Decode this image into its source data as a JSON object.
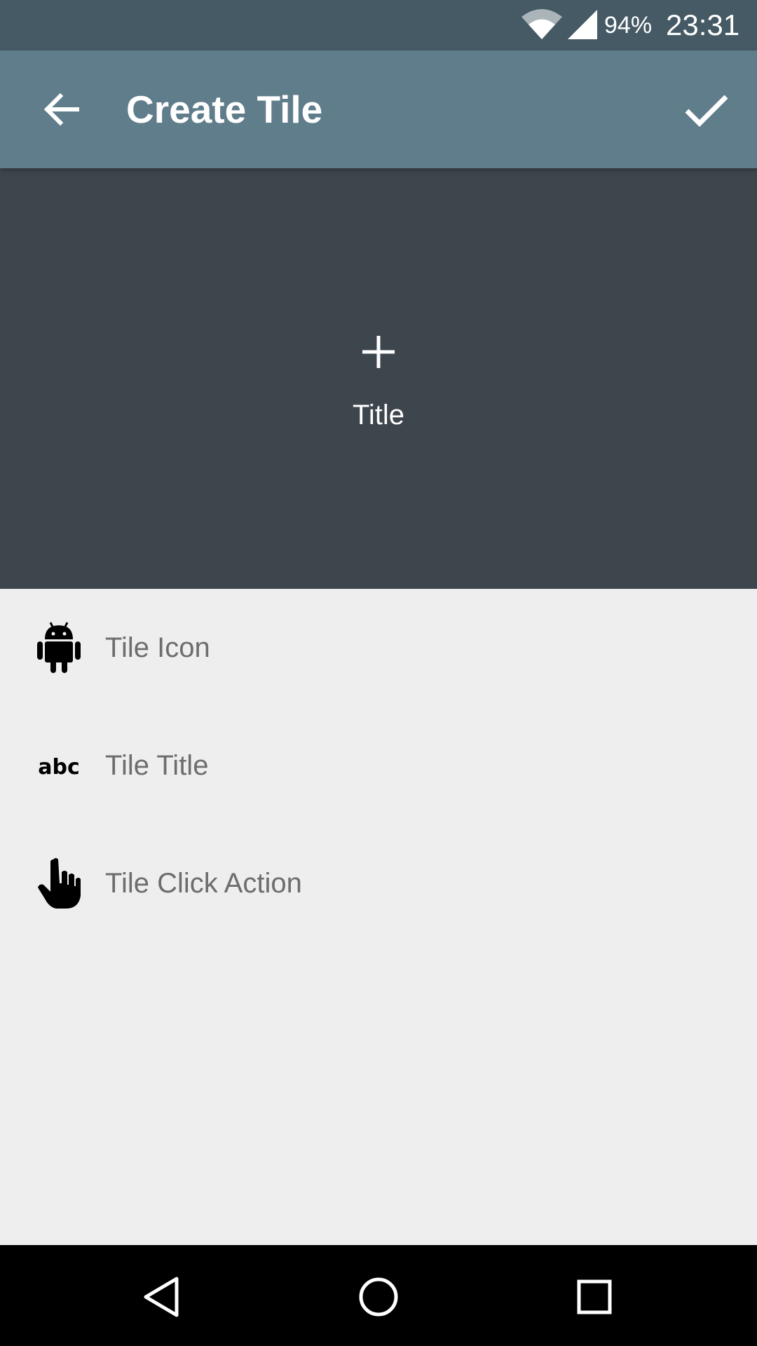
{
  "status_bar": {
    "battery": "94%",
    "time": "23:31",
    "icons": [
      "wifi-icon",
      "cell-signal-icon"
    ]
  },
  "app_bar": {
    "title": "Create Tile",
    "back_icon": "arrow-back-icon",
    "confirm_icon": "check-icon"
  },
  "preview": {
    "icon": "plus-icon",
    "title": "Title"
  },
  "options": [
    {
      "label": "Tile Icon",
      "icon": "android-icon"
    },
    {
      "label": "Tile Title",
      "icon": "abc-text-icon"
    },
    {
      "label": "Tile Click Action",
      "icon": "touch-hand-icon"
    }
  ],
  "nav_bar": {
    "icons": [
      "back-triangle-icon",
      "home-circle-icon",
      "recents-square-icon"
    ]
  },
  "colors": {
    "status_bar": "#455a64",
    "app_bar": "#607d8b",
    "preview_bg": "#3e464d",
    "body_bg": "#eeeeee",
    "option_text": "#6d6d6d"
  }
}
